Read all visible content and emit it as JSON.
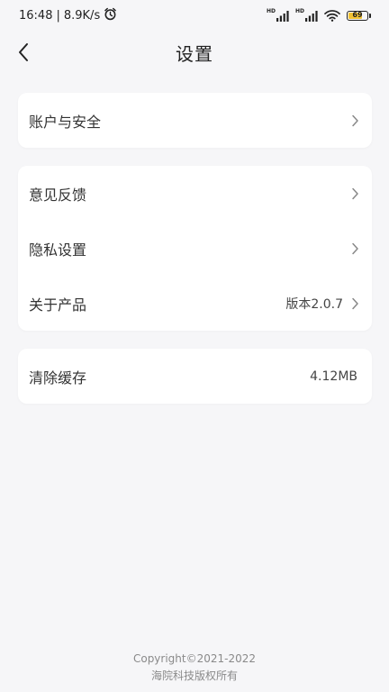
{
  "status_bar": {
    "time": "16:48",
    "separator": "|",
    "speed": "8.9K/s",
    "signal1_label": "HD",
    "signal2_label": "HD",
    "battery": "69"
  },
  "nav": {
    "title": "设置"
  },
  "groups": [
    {
      "items": [
        {
          "label": "账户与安全"
        }
      ]
    },
    {
      "items": [
        {
          "label": "意见反馈"
        },
        {
          "label": "隐私设置"
        },
        {
          "label": "关于产品",
          "value": "版本2.0.7"
        }
      ]
    },
    {
      "items": [
        {
          "label": "清除缓存",
          "value": "4.12MB"
        }
      ]
    }
  ],
  "footer": {
    "copyright": "Copyright©2021-2022",
    "owner": "海院科技版权所有"
  },
  "colors": {
    "background": "#f6f6f8",
    "card": "#ffffff",
    "battery_fill": "#f2c233"
  }
}
